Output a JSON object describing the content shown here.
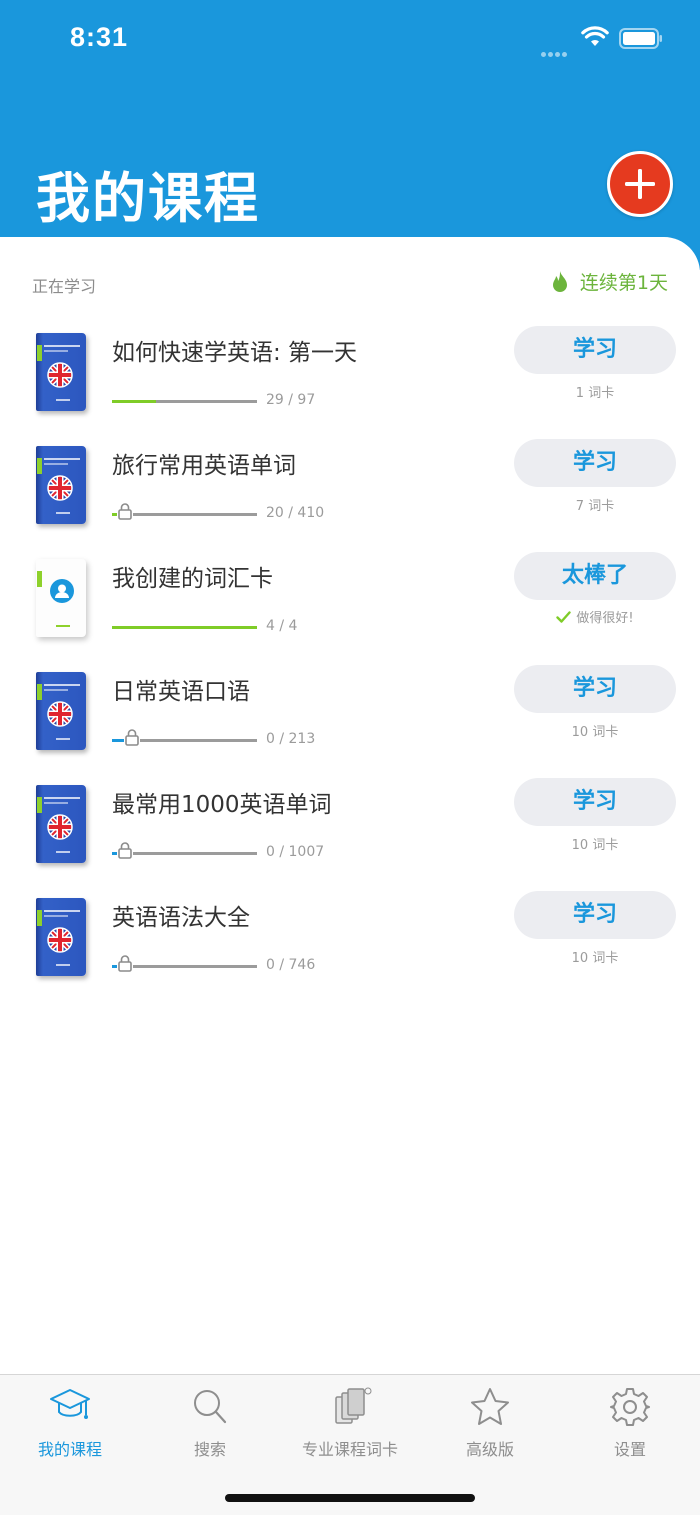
{
  "status_bar": {
    "time": "8:31"
  },
  "header": {
    "title": "我的课程",
    "add_icon": "plus-icon"
  },
  "section": {
    "label": "正在学习",
    "streak": "连续第1天",
    "streak_icon": "flame-icon"
  },
  "colors": {
    "brand_blue": "#1a97dc",
    "add_red": "#e53a1f",
    "progress_green": "#7fcc28",
    "streak_green": "#6cb43c"
  },
  "courses": [
    {
      "title": "如何快速学英语: 第一天",
      "count": "29 / 97",
      "progress": 0.3,
      "locked": false,
      "button": "学习",
      "sub": "1 词卡"
    },
    {
      "title": "旅行常用英语单词",
      "count": "20 / 410",
      "progress": 0.05,
      "locked": true,
      "button": "学习",
      "sub": "7 词卡"
    },
    {
      "title": "我创建的词汇卡",
      "count": "4 / 4",
      "progress": 1.0,
      "locked": false,
      "button": "太棒了",
      "sub": "做得很好!"
    },
    {
      "title": "日常英语口语",
      "count": "0 / 213",
      "progress": 0.0,
      "locked": true,
      "button": "学习",
      "sub": "10 词卡"
    },
    {
      "title": "最常用1000英语单词",
      "count": "0 / 1007",
      "progress": 0.0,
      "locked": true,
      "button": "学习",
      "sub": "10 词卡"
    },
    {
      "title": "英语语法大全",
      "count": "0 / 746",
      "progress": 0.0,
      "locked": true,
      "button": "学习",
      "sub": "10 词卡"
    }
  ],
  "tabs": [
    {
      "label": "我的课程",
      "icon": "graduation-cap-icon",
      "active": true
    },
    {
      "label": "搜索",
      "icon": "search-icon",
      "active": false
    },
    {
      "label": "专业课程词卡",
      "icon": "flashcards-icon",
      "active": false
    },
    {
      "label": "高级版",
      "icon": "star-icon",
      "active": false
    },
    {
      "label": "设置",
      "icon": "gear-icon",
      "active": false
    }
  ]
}
